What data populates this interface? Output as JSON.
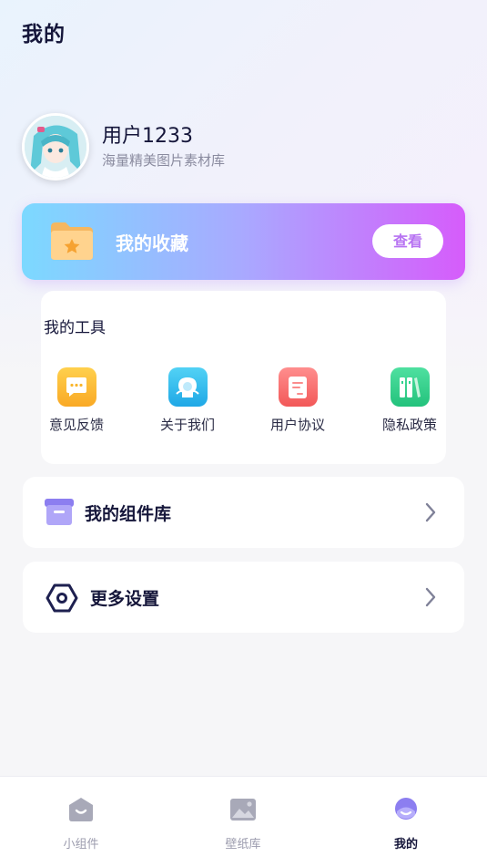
{
  "header": {
    "title": "我的"
  },
  "profile": {
    "name": "用户1233",
    "subtitle": "海量精美图片素材库"
  },
  "favorites": {
    "label": "我的收藏",
    "button_label": "查看"
  },
  "tools": {
    "title": "我的工具",
    "items": [
      {
        "label": "意见反馈",
        "icon": "feedback-icon",
        "color": "#f9b52c"
      },
      {
        "label": "关于我们",
        "icon": "about-icon",
        "color": "#2cb7ee"
      },
      {
        "label": "用户协议",
        "icon": "agreement-icon",
        "color": "#fa6c6c"
      },
      {
        "label": "隐私政策",
        "icon": "privacy-icon",
        "color": "#2fd38c"
      }
    ]
  },
  "rows": [
    {
      "label": "我的组件库",
      "icon": "widget-box-icon"
    },
    {
      "label": "更多设置",
      "icon": "settings-hexagon-icon"
    }
  ],
  "tab_bar": {
    "items": [
      {
        "label": "小组件",
        "icon": "widget-home-icon",
        "active": false
      },
      {
        "label": "壁纸库",
        "icon": "wallpaper-icon",
        "active": false
      },
      {
        "label": "我的",
        "icon": "profile-icon",
        "active": true
      }
    ]
  },
  "colors": {
    "accent": "#b773f2",
    "gradient_start": "#7cd9ff",
    "gradient_end": "#d65cfb",
    "text_dark": "#15163a"
  }
}
